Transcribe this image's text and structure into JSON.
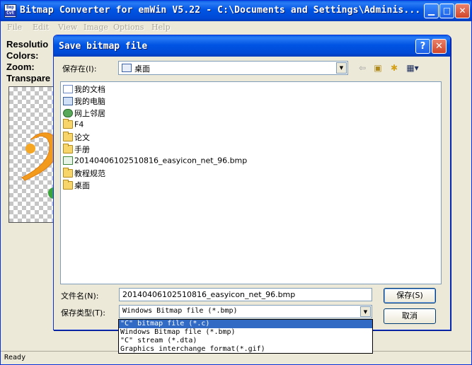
{
  "main": {
    "title": "Bitmap Converter for emWin V5.22 - C:\\Documents and Settings\\Adminis...",
    "icon_text_top": "Bmp",
    "icon_text_bottom": "Cvt",
    "menu": [
      "File",
      "Edit",
      "View",
      "Image",
      "Options",
      "Help"
    ],
    "info_labels": [
      "Resolutio",
      "Colors:",
      "Zoom:",
      "Transpare"
    ],
    "status": "Ready"
  },
  "dialog": {
    "title": "Save bitmap file",
    "save_in_label": "保存在(I):",
    "save_in_value": "桌面",
    "files": [
      {
        "name": "我的文档",
        "icon": "my-documents-icon"
      },
      {
        "name": "我的电脑",
        "icon": "my-computer-icon"
      },
      {
        "name": "网上邻居",
        "icon": "network-places-icon"
      },
      {
        "name": "F4",
        "icon": "folder-icon"
      },
      {
        "name": "论文",
        "icon": "folder-icon"
      },
      {
        "name": "手册",
        "icon": "folder-icon"
      },
      {
        "name": "20140406102510816_easyicon_net_96.bmp",
        "icon": "bmp-file-icon"
      },
      {
        "name": "教程规范",
        "icon": "folder-shortcut-icon"
      },
      {
        "name": "桌面",
        "icon": "folder-shortcut-icon"
      }
    ],
    "filename_label": "文件名(N):",
    "filename_value": "20140406102510816_easyicon_net_96.bmp",
    "filetype_label": "保存类型(T):",
    "filetype_value": "Windows Bitmap file (*.bmp)",
    "save_button": "保存(S)",
    "cancel_button": "取消",
    "filetype_options": [
      "\"C\" bitmap file (*.c)",
      "Windows Bitmap file (*.bmp)",
      "\"C\" stream (*.dta)",
      "Graphics interchange format(*.gif)"
    ],
    "highlighted_option": "\"C\" bitmap file (*.c)"
  },
  "colors": {
    "titlebar_blue": "#0054e3",
    "selection_blue": "#316ac5",
    "close_red": "#d1462a",
    "window_face": "#ece9d8"
  }
}
